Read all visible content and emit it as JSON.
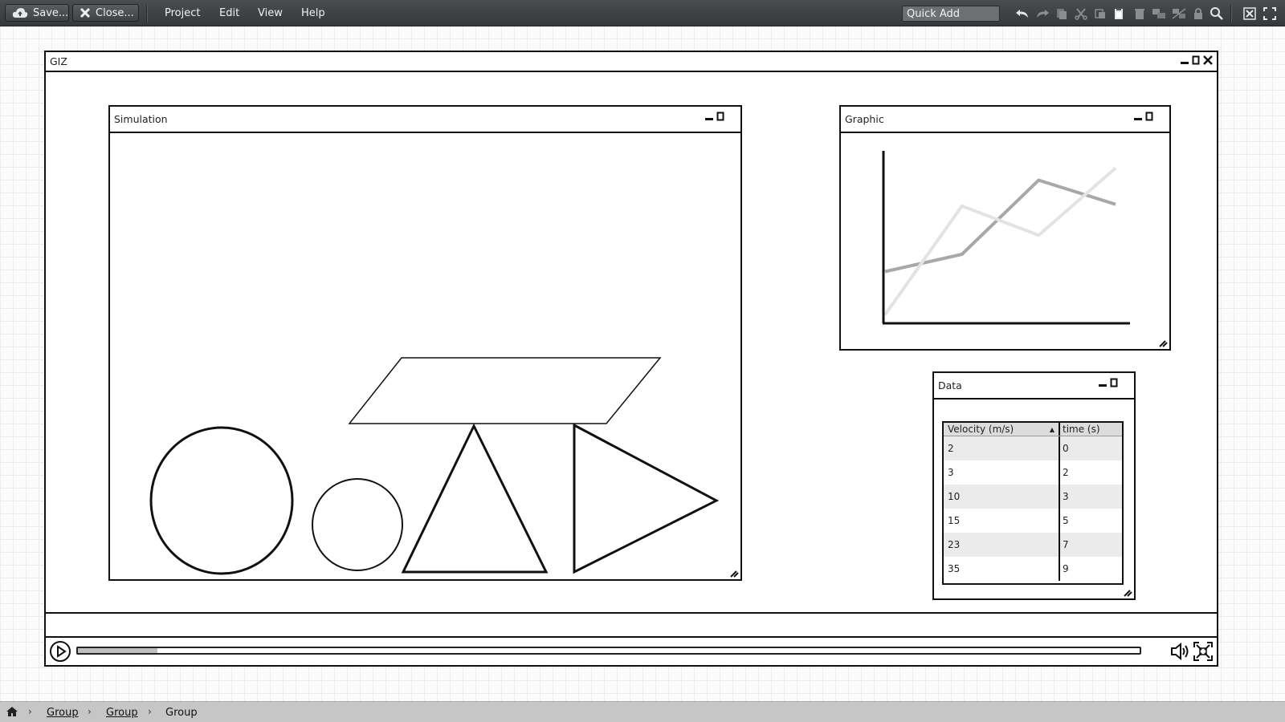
{
  "toolbar": {
    "save_label": "Save...",
    "close_label": "Close...",
    "menus": [
      "Project",
      "Edit",
      "View",
      "Help"
    ],
    "quick_add_placeholder": "Quick Add",
    "icons": [
      "undo-icon",
      "redo-icon",
      "duplicate-icon",
      "cut-icon",
      "copy-icon",
      "paste-icon",
      "delete-icon",
      "group-icon",
      "ungroup-icon",
      "lock-icon",
      "search-icon",
      "close-mockup-icon",
      "fullscreen-icon"
    ]
  },
  "window": {
    "title": "GIZ"
  },
  "simulation": {
    "title": "Simulation"
  },
  "graphic": {
    "title": "Graphic",
    "chart_data": {
      "type": "line",
      "x": [
        0,
        1,
        2,
        3
      ],
      "series": [
        {
          "values": [
            0.05,
            0.68,
            0.51,
            0.9
          ],
          "color": "#e3e3e3"
        },
        {
          "values": [
            0.3,
            0.4,
            0.83,
            0.69
          ],
          "color": "#a8a8a8"
        }
      ],
      "grid": false
    }
  },
  "data": {
    "title": "Data",
    "columns": [
      "Velocity (m/s)",
      "time (s)"
    ],
    "rows": [
      [
        "2",
        "0"
      ],
      [
        "3",
        "2"
      ],
      [
        "10",
        "3"
      ],
      [
        "15",
        "5"
      ],
      [
        "23",
        "7"
      ],
      [
        "35",
        "9"
      ]
    ]
  },
  "video": {
    "progress": 0.075
  },
  "breadcrumb": {
    "items": [
      "Group",
      "Group",
      "Group"
    ]
  }
}
